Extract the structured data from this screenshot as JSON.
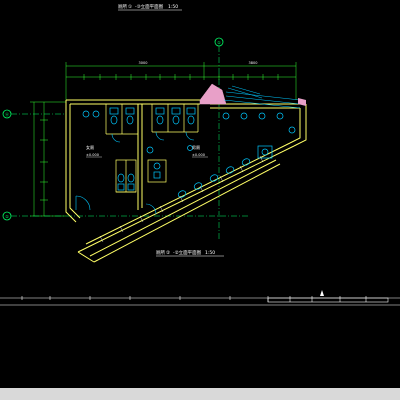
{
  "drawing": {
    "top_title": {
      "prefix": "厕所",
      "code": "①",
      "name": "-③立面平面图",
      "scale": "1:50"
    },
    "bottom_title": {
      "prefix": "厕所",
      "code": "②",
      "name": "-②立面平面图",
      "scale": "1:50"
    },
    "axis_top": "①",
    "axis_left_upper": "Ⓐ",
    "axis_left_lower": "①",
    "room_left": "女厕",
    "room_right": "男厕",
    "level_left": "±0.000",
    "level_right": "±0.000",
    "dim_top_left_total": "3000",
    "dim_top_right_total": "3800"
  },
  "colors": {
    "background": "#000000",
    "wall": "#ffff66",
    "dimension": "#33ff33",
    "fixture": "#00c8ff",
    "text": "#ffffff",
    "axis": "#00ff66",
    "hatch": "#e8a0c8",
    "status_bar": "#d9d9d9"
  }
}
